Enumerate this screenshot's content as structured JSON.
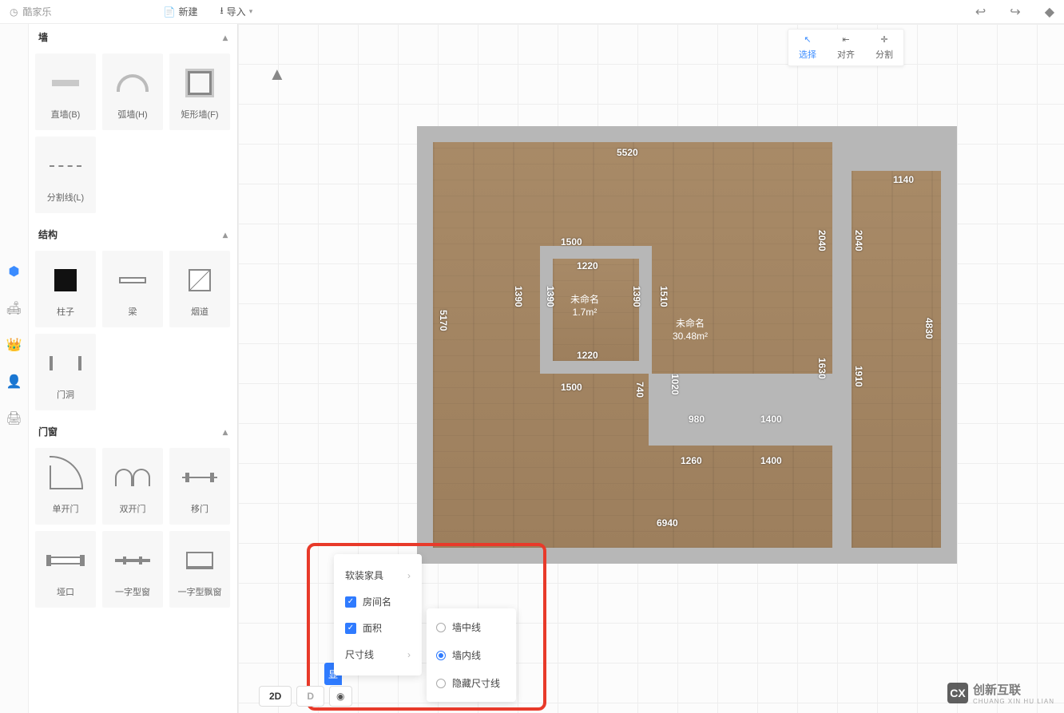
{
  "app": {
    "name": "酷家乐"
  },
  "topbar": {
    "new": "新建",
    "import": "导入"
  },
  "leftnav": [
    "home",
    "sofa",
    "crown",
    "user",
    "printer"
  ],
  "panel": {
    "sections": {
      "wall": {
        "title": "墙",
        "tiles": [
          {
            "label": "直墙(B)"
          },
          {
            "label": "弧墙(H)"
          },
          {
            "label": "矩形墙(F)"
          },
          {
            "label": "分割线(L)"
          }
        ]
      },
      "struct": {
        "title": "结构",
        "tiles": [
          {
            "label": "柱子"
          },
          {
            "label": "梁"
          },
          {
            "label": "烟道"
          },
          {
            "label": "门洞"
          }
        ]
      },
      "doorwin": {
        "title": "门窗",
        "tiles": [
          {
            "label": "单开门"
          },
          {
            "label": "双开门"
          },
          {
            "label": "移门"
          },
          {
            "label": "垭口"
          },
          {
            "label": "一字型窗"
          },
          {
            "label": "一字型飘窗"
          }
        ]
      }
    }
  },
  "modebar": {
    "select": "选择",
    "align": "对齐",
    "split": "分割"
  },
  "rooms": {
    "small": {
      "name": "未命名",
      "area": "1.7m²"
    },
    "big": {
      "name": "未命名",
      "area": "30.48m²"
    }
  },
  "dims": {
    "top": "5520",
    "right_small": "1140",
    "left": "5170",
    "inner_top": "1500",
    "inner_top2": "1220",
    "inner_left": "1390",
    "inner_left2": "1390",
    "inner_right": "1390",
    "inner_right2": "1510",
    "inner_bot": "1220",
    "inner_bot_out": "1500",
    "inner_down": "740",
    "col_right1": "2040",
    "col_right2": "2040",
    "col_right3": "1630",
    "col_right4": "1910",
    "col_right5": "4830",
    "midrow1": "980",
    "midrow2": "1400",
    "midrow3": "1020",
    "botrow1": "1260",
    "botrow2": "1400",
    "bottom": "6940"
  },
  "popup1": {
    "soft": "软装家具",
    "room": "房间名",
    "area": "面积",
    "dim": "尺寸线",
    "btn": "显"
  },
  "popup2": {
    "center": "墙中线",
    "inner": "墙内线",
    "hide": "隐藏尺寸线"
  },
  "bottom": {
    "d2": "2D",
    "d3": "D"
  },
  "watermark": {
    "brand": "创新互联",
    "sub": "CHUANG XIN HU LIAN"
  }
}
